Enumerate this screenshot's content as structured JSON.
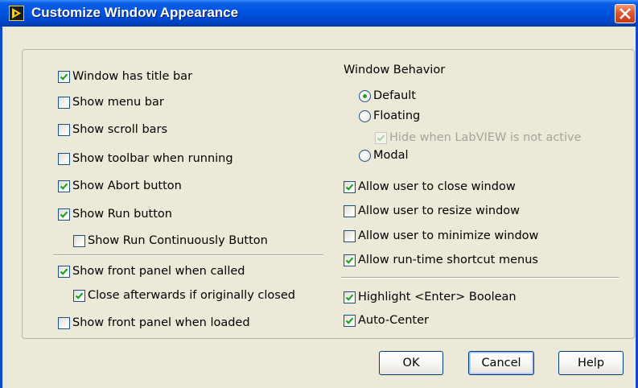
{
  "window": {
    "title": "Customize Window Appearance"
  },
  "left_options": [
    {
      "label": "Window has title bar",
      "checked": true
    },
    {
      "label": "Show menu bar",
      "checked": false
    },
    {
      "label": "Show scroll bars",
      "checked": false
    },
    {
      "label": "Show toolbar when running",
      "checked": false
    },
    {
      "label": "Show Abort button",
      "checked": true
    },
    {
      "label": "Show Run button",
      "checked": true
    },
    {
      "label": "Show Run Continuously Button",
      "checked": false
    },
    {
      "label": "Show front panel when called",
      "checked": true
    },
    {
      "label": "Close afterwards if originally closed",
      "checked": true
    },
    {
      "label": "Show front panel when loaded",
      "checked": false
    }
  ],
  "window_behavior": {
    "heading": "Window Behavior",
    "options": [
      {
        "label": "Default",
        "selected": true
      },
      {
        "label": "Floating",
        "selected": false
      },
      {
        "label": "Modal",
        "selected": false
      }
    ],
    "hide_when_inactive": {
      "label": "Hide when LabVIEW is not active",
      "checked": true,
      "enabled": false
    }
  },
  "right_options": [
    {
      "label": "Allow user to close window",
      "checked": true
    },
    {
      "label": "Allow user to resize window",
      "checked": false
    },
    {
      "label": "Allow user to minimize window",
      "checked": false
    },
    {
      "label": "Allow run-time shortcut menus",
      "checked": true
    },
    {
      "label": "Highlight <Enter> Boolean",
      "checked": true
    },
    {
      "label": "Auto-Center",
      "checked": true
    }
  ],
  "buttons": {
    "ok": "OK",
    "cancel": "Cancel",
    "help": "Help"
  },
  "colors": {
    "title_bar": "#0054e3",
    "dialog_bg": "#ece9d8",
    "check_mark": "#21a121",
    "close_button": "#e2552c"
  }
}
